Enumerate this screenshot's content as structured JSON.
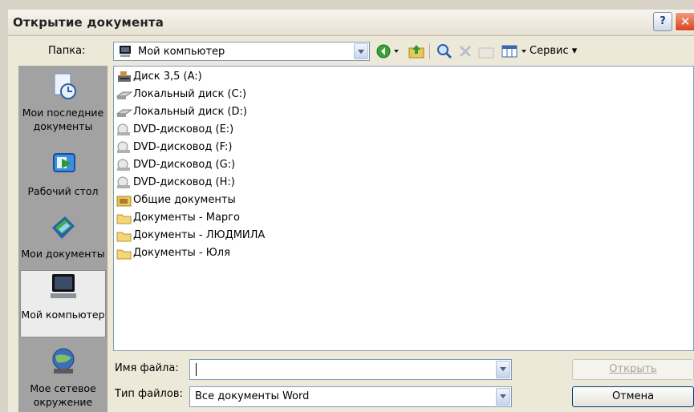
{
  "window": {
    "title": "Открытие документа",
    "help_label": "?",
    "close_label": "✕"
  },
  "folder": {
    "label": "Папка:",
    "value": "Мой компьютер"
  },
  "toolbar": {
    "service_label": "Сервис"
  },
  "places": [
    {
      "label": "Мои последние документы",
      "icon": "recent-documents-icon"
    },
    {
      "label": "Рабочий стол",
      "icon": "desktop-icon"
    },
    {
      "label": "Мои документы",
      "icon": "my-documents-icon"
    },
    {
      "label": "Мой компьютер",
      "icon": "my-computer-icon",
      "selected": true
    },
    {
      "label": "Мое сетевое окружение",
      "icon": "network-places-icon"
    }
  ],
  "files": [
    {
      "label": "Диск 3,5 (A:)",
      "icon": "floppy-drive-icon"
    },
    {
      "label": "Локальный диск (C:)",
      "icon": "hard-disk-icon"
    },
    {
      "label": "Локальный диск (D:)",
      "icon": "hard-disk-icon"
    },
    {
      "label": "DVD-дисковод (E:)",
      "icon": "dvd-drive-icon"
    },
    {
      "label": "DVD-дисковод (F:)",
      "icon": "dvd-drive-icon"
    },
    {
      "label": "DVD-дисковод (G:)",
      "icon": "dvd-drive-icon"
    },
    {
      "label": "DVD-дисковод (H:)",
      "icon": "dvd-drive-icon"
    },
    {
      "label": "Общие документы",
      "icon": "shared-folder-icon"
    },
    {
      "label": "Документы - Марго",
      "icon": "folder-icon"
    },
    {
      "label": "Документы - ЛЮДМИЛА",
      "icon": "folder-icon"
    },
    {
      "label": "Документы - Юля",
      "icon": "folder-icon"
    }
  ],
  "filename": {
    "label": "Имя файла:",
    "value": ""
  },
  "filetype": {
    "label": "Тип файлов:",
    "value": "Все документы Word"
  },
  "buttons": {
    "open": "Открыть",
    "cancel": "Отмена"
  },
  "colors": {
    "title_close": "#d64522",
    "places_bg": "#a2a2a2",
    "dialog_bg": "#ece9d8"
  }
}
